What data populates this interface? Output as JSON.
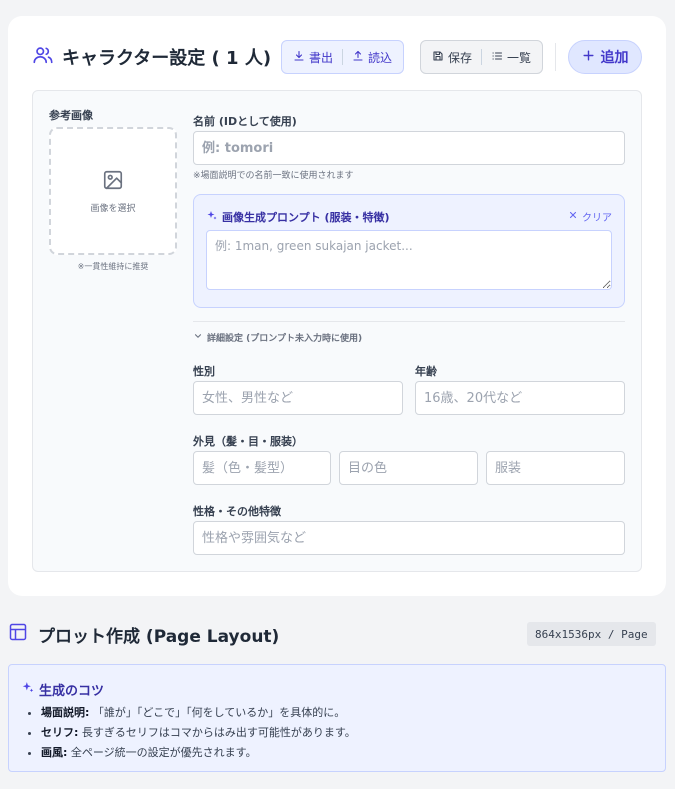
{
  "character": {
    "title": "キャラクター設定 ( 1 人)",
    "toolbar": {
      "export_label": "書出",
      "import_label": "読込",
      "save_label": "保存",
      "list_label": "一覧",
      "add_label": "追加"
    },
    "reference": {
      "label": "参考画像",
      "select_label": "画像を選択",
      "note": "※一貫性維持に推奨"
    },
    "name": {
      "label": "名前 (IDとして使用)",
      "value": "",
      "placeholder": "例: tomori",
      "hint": "※場面説明での名前一致に使用されます"
    },
    "prompt": {
      "title": "画像生成プロンプト (服装・特徴)",
      "clear_label": "クリア",
      "value": "",
      "placeholder": "例: 1man, green sukajan jacket..."
    },
    "details": {
      "toggle_label": "詳細設定 (プロンプト未入力時に使用)",
      "gender": {
        "label": "性別",
        "value": "",
        "placeholder": "女性、男性など"
      },
      "age": {
        "label": "年齢",
        "value": "",
        "placeholder": "16歳、20代など"
      },
      "appearance": {
        "label": "外見（髪・目・服装）",
        "hair_placeholder": "髪（色・髪型）",
        "eyes_placeholder": "目の色",
        "clothes_placeholder": "服装"
      },
      "personality": {
        "label": "性格・その他特徴",
        "value": "",
        "placeholder": "性格や雰囲気など"
      }
    }
  },
  "plot": {
    "title": "プロット作成 (Page Layout)",
    "size_badge": "864x1536px / Page"
  },
  "tips": {
    "title": "生成のコツ",
    "items": [
      {
        "term": "場面説明:",
        "text": " 「誰が」「どこで」「何をしているか」を具体的に。"
      },
      {
        "term": "セリフ:",
        "text": " 長すぎるセリフはコマからはみ出す可能性があります。"
      },
      {
        "term": "画風:",
        "text": " 全ページ統一の設定が優先されます。"
      }
    ]
  },
  "colors": {
    "accent": "#4338ca",
    "accent_light": "#eef2ff",
    "border": "#d1d5db"
  }
}
